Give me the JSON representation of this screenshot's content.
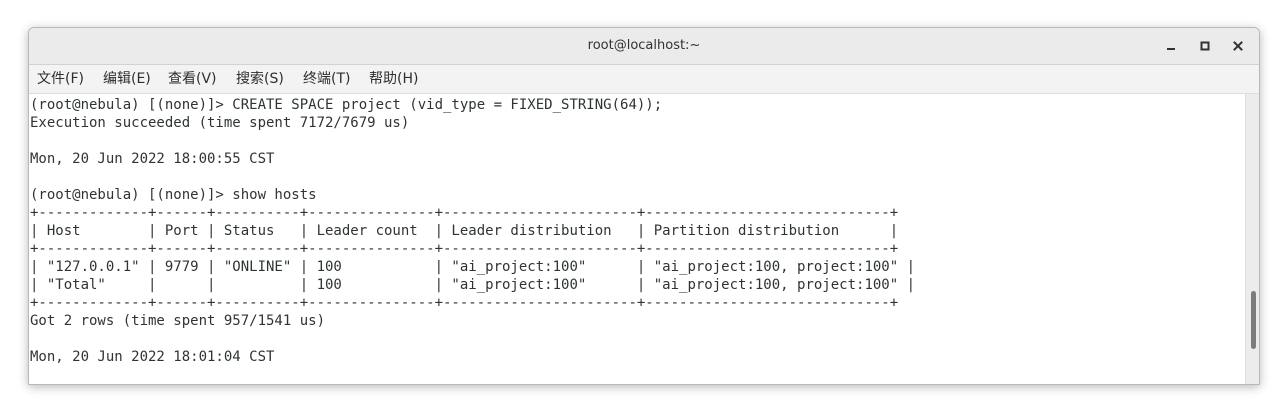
{
  "window": {
    "title": "root@localhost:~"
  },
  "menu": [
    {
      "label": "文件(F)"
    },
    {
      "label": "编辑(E)"
    },
    {
      "label": "查看(V)"
    },
    {
      "label": "搜索(S)"
    },
    {
      "label": "终端(T)"
    },
    {
      "label": "帮助(H)"
    }
  ],
  "terminal": {
    "lines": [
      "(root@nebula) [(none)]> CREATE SPACE project (vid_type = FIXED_STRING(64));",
      "Execution succeeded (time spent 7172/7679 us)",
      "",
      "Mon, 20 Jun 2022 18:00:55 CST",
      "",
      "(root@nebula) [(none)]> show hosts",
      "+-------------+------+----------+---------------+-----------------------+-----------------------------+",
      "| Host        | Port | Status   | Leader count  | Leader distribution   | Partition distribution      |",
      "+-------------+------+----------+---------------+-----------------------+-----------------------------+",
      "| \"127.0.0.1\" | 9779 | \"ONLINE\" | 100           | \"ai_project:100\"      | \"ai_project:100, project:100\" |",
      "| \"Total\"     |      |          | 100           | \"ai_project:100\"      | \"ai_project:100, project:100\" |",
      "+-------------+------+----------+---------------+-----------------------+-----------------------------+",
      "Got 2 rows (time spent 957/1541 us)",
      "",
      "Mon, 20 Jun 2022 18:01:04 CST"
    ]
  },
  "scroll": {
    "position_fraction": 0.86
  }
}
